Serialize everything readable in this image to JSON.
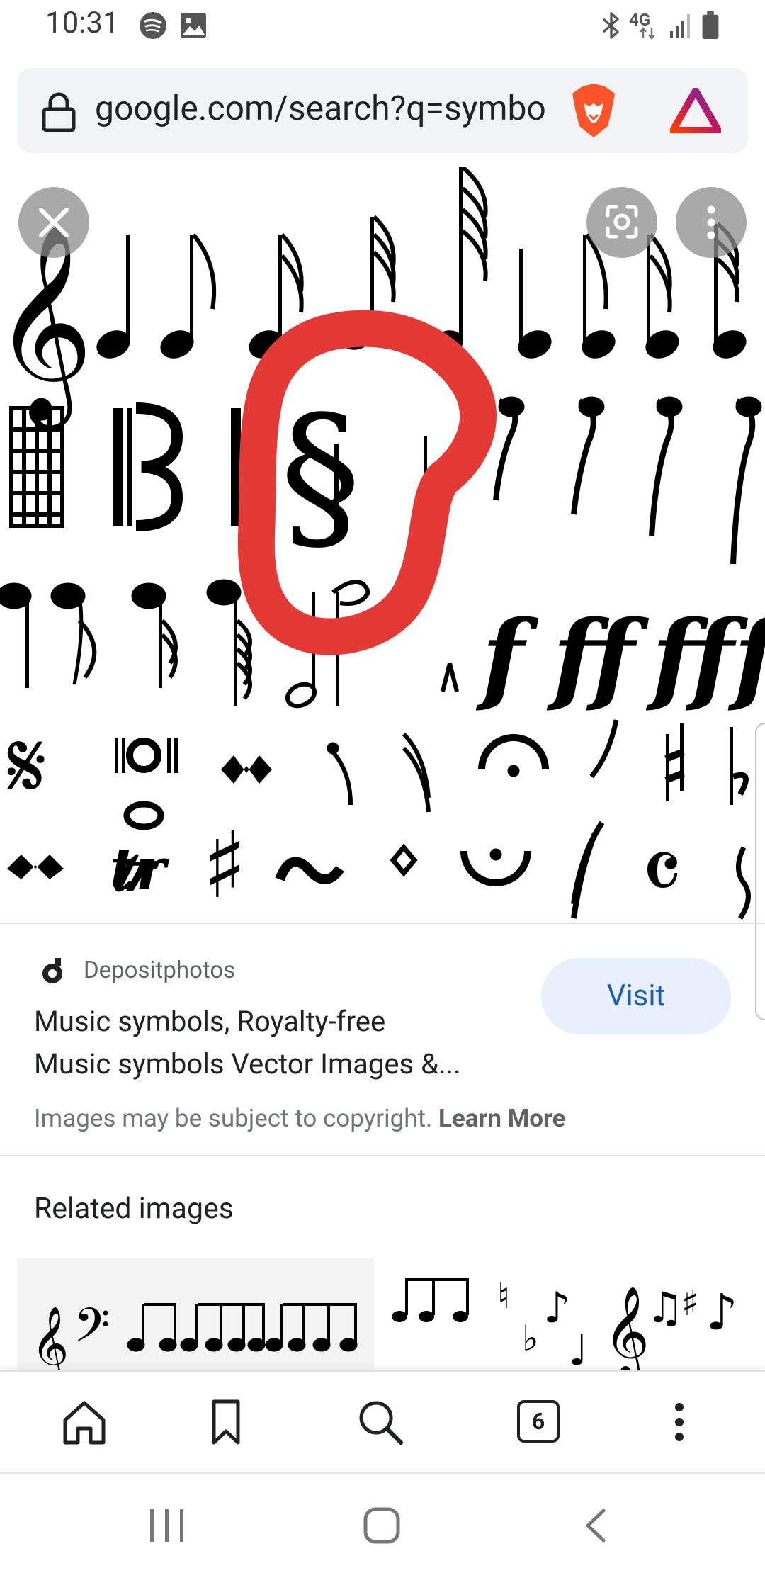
{
  "status_bar": {
    "time": "10:31",
    "left_icons": [
      "spotify-icon",
      "gallery-icon"
    ],
    "right_icons": [
      "bluetooth-icon",
      "4g-lte-icon",
      "signal-icon",
      "battery-icon"
    ],
    "network_label": "4G"
  },
  "url_bar": {
    "url": "google.com/search?q=symbo",
    "lock_icon": "lock-icon",
    "brave_icon": "brave-lion-icon",
    "rewards_icon": "brave-rewards-triangle-icon"
  },
  "image_viewer": {
    "close_icon": "close-icon",
    "lens_icon": "google-lens-icon",
    "more_icon": "more-vert-icon",
    "highlight_color": "#e53935"
  },
  "result": {
    "source": "Depositphotos",
    "source_icon": "depositphotos-logo-icon",
    "title_line1": "Music symbols, Royalty-free",
    "title_line2": "Music symbols Vector Images &...",
    "visit_label": "Visit",
    "copyright_text": "Images may be subject to copyright.",
    "learn_more": "Learn More"
  },
  "related": {
    "title": "Related images"
  },
  "bottom_bar": {
    "home_icon": "home-icon",
    "bookmark_icon": "bookmark-icon",
    "search_icon": "search-icon",
    "tab_count": "6",
    "menu_icon": "more-vert-icon"
  },
  "system_nav": {
    "recents_icon": "recent-apps-icon",
    "home_icon": "home-circle-icon",
    "back_icon": "back-chevron-icon"
  },
  "colors": {
    "visit_bg": "#e8f0fe",
    "visit_text": "#1a5fb4",
    "url_bg": "#f1f3f4",
    "highlight": "#e53935"
  }
}
